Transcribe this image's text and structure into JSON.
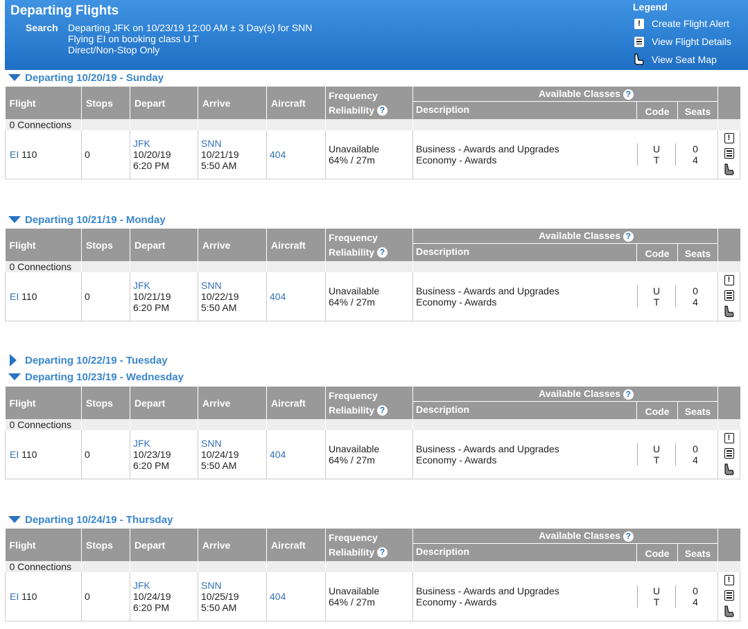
{
  "header": {
    "title": "Departing Flights",
    "search_label": "Search",
    "search_lines": [
      "Departing JFK on 10/23/19 12:00 AM ± 3 Day(s) for SNN",
      "Flying EI on booking class U T",
      "Direct/Non-Stop Only"
    ]
  },
  "legend": {
    "title": "Legend",
    "items": [
      {
        "icon": "alert-icon",
        "label": "Create Flight Alert"
      },
      {
        "icon": "flight-details-icon",
        "label": "View Flight Details"
      },
      {
        "icon": "seat-map-icon",
        "label": "View Seat Map"
      }
    ]
  },
  "columns": {
    "flight": "Flight",
    "stops": "Stops",
    "depart": "Depart",
    "arrive": "Arrive",
    "aircraft": "Aircraft",
    "frequency": "Frequency",
    "reliability": "Reliability",
    "available_classes": "Available Classes",
    "description": "Description",
    "code": "Code",
    "seats": "Seats"
  },
  "days": [
    {
      "label": "Departing 10/20/19 - Sunday",
      "connections": "0 Connections",
      "flight": {
        "airline": "EI",
        "number": "110",
        "stops": "0",
        "dep_airport": "JFK",
        "dep_date": "10/20/19",
        "dep_time": "6:20 PM",
        "arr_airport": "SNN",
        "arr_date": "10/21/19",
        "arr_time": "5:50 AM",
        "aircraft": "404",
        "frequency": "Unavailable",
        "reliability": "64% / 27m",
        "classes": [
          {
            "description": "Business - Awards and Upgrades",
            "code": "U",
            "seats": "0"
          },
          {
            "description": "Economy - Awards",
            "code": "T",
            "seats": "4"
          }
        ]
      }
    },
    {
      "label": "Departing 10/21/19 - Monday",
      "connections": "0 Connections",
      "flight": {
        "airline": "EI",
        "number": "110",
        "stops": "0",
        "dep_airport": "JFK",
        "dep_date": "10/21/19",
        "dep_time": "6:20 PM",
        "arr_airport": "SNN",
        "arr_date": "10/22/19",
        "arr_time": "5:50 AM",
        "aircraft": "404",
        "frequency": "Unavailable",
        "reliability": "64% / 27m",
        "classes": [
          {
            "description": "Business - Awards and Upgrades",
            "code": "U",
            "seats": "0"
          },
          {
            "description": "Economy - Awards",
            "code": "T",
            "seats": "4"
          }
        ]
      }
    },
    {
      "label": "Departing 10/22/19 - Tuesday",
      "collapsed": true
    },
    {
      "label": "Departing 10/23/19 - Wednesday",
      "connections": "0 Connections",
      "flight": {
        "airline": "EI",
        "number": "110",
        "stops": "0",
        "dep_airport": "JFK",
        "dep_date": "10/23/19",
        "dep_time": "6:20 PM",
        "arr_airport": "SNN",
        "arr_date": "10/24/19",
        "arr_time": "5:50 AM",
        "aircraft": "404",
        "frequency": "Unavailable",
        "reliability": "64% / 27m",
        "classes": [
          {
            "description": "Business - Awards and Upgrades",
            "code": "U",
            "seats": "0"
          },
          {
            "description": "Economy - Awards",
            "code": "T",
            "seats": "4"
          }
        ]
      }
    },
    {
      "label": "Departing 10/24/19 - Thursday",
      "connections": "0 Connections",
      "flight": {
        "airline": "EI",
        "number": "110",
        "stops": "0",
        "dep_airport": "JFK",
        "dep_date": "10/24/19",
        "dep_time": "6:20 PM",
        "arr_airport": "SNN",
        "arr_date": "10/25/19",
        "arr_time": "5:50 AM",
        "aircraft": "404",
        "frequency": "Unavailable",
        "reliability": "64% / 27m",
        "classes": [
          {
            "description": "Business - Awards and Upgrades",
            "code": "U",
            "seats": "0"
          },
          {
            "description": "Economy - Awards",
            "code": "T",
            "seats": "4"
          }
        ]
      }
    }
  ]
}
